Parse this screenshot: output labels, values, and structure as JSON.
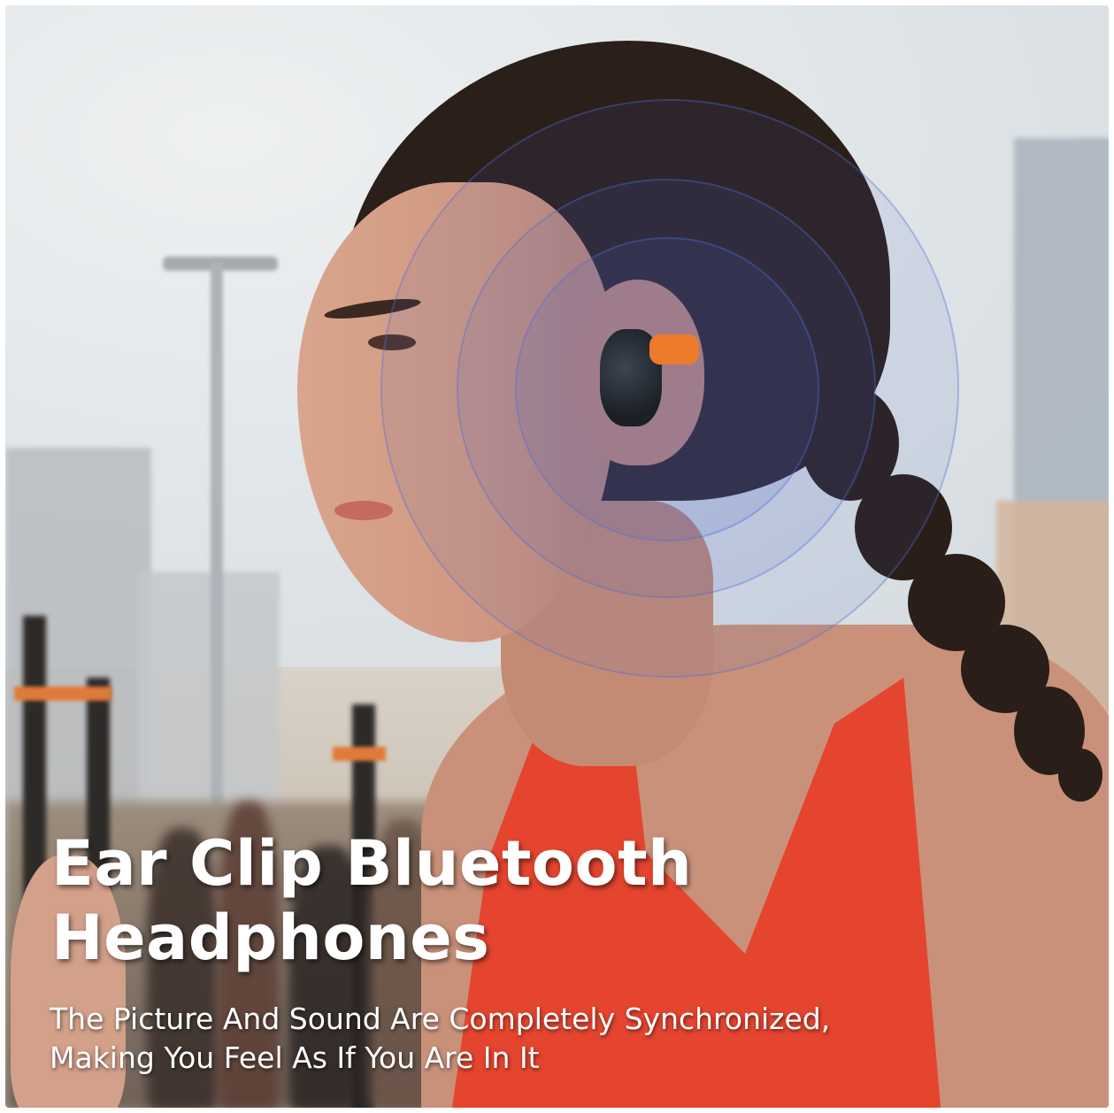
{
  "headline": {
    "line1": "Ear Clip Bluetooth",
    "line2": "Headphones"
  },
  "subline": {
    "line1": "The Picture And Sound Are Completely Synchronized,",
    "line2": "Making You Feel As If You Are In It"
  },
  "colors": {
    "text": "#ffffff",
    "tank_top": "#e5452f",
    "earbud_accent": "#ee7a2c",
    "sound_rings": "#5070dc"
  }
}
